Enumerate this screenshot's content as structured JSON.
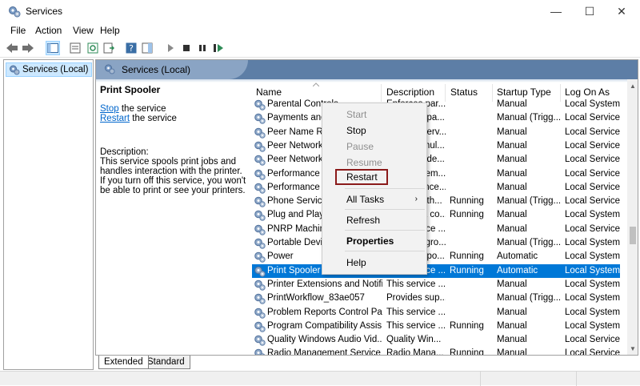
{
  "window": {
    "title": "Services",
    "controls": {
      "minimize": "—",
      "maximize": "☐",
      "close": "✕"
    }
  },
  "menu": [
    "File",
    "Action",
    "View",
    "Help"
  ],
  "tree": {
    "item": "Services (Local)"
  },
  "panel": {
    "header": "Services (Local)",
    "selected_service": "Print Spooler",
    "stop_link": "Stop",
    "stop_rest": " the service",
    "restart_link": "Restart",
    "restart_rest": " the service",
    "description_label": "Description:",
    "description_lines": [
      "This service spools print jobs and",
      "handles interaction with the printer.",
      "If you turn off this service, you won't",
      "be able to print or see your printers."
    ]
  },
  "columns": [
    "Name",
    "Description",
    "Status",
    "Startup Type",
    "Log On As"
  ],
  "rows": [
    {
      "name": "Parental Controls",
      "desc": "Enforces par...",
      "status": "",
      "startup": "Manual",
      "logon": "Local System"
    },
    {
      "name": "Payments and NFC/SE Ma...",
      "desc": "Manages pa...",
      "status": "",
      "startup": "Manual (Trigg...",
      "logon": "Local Service"
    },
    {
      "name": "Peer Name Resolution Pr...",
      "desc": "Enables serv...",
      "status": "",
      "startup": "Manual",
      "logon": "Local Service"
    },
    {
      "name": "Peer Networking Groupi...",
      "desc": "Enables mul...",
      "status": "",
      "startup": "Manual",
      "logon": "Local Service"
    },
    {
      "name": "Peer Networking Identity...",
      "desc": "Provides ide...",
      "status": "",
      "startup": "Manual",
      "logon": "Local Service"
    },
    {
      "name": "Performance Counter DL...",
      "desc": "Enables rem...",
      "status": "",
      "startup": "Manual",
      "logon": "Local Service"
    },
    {
      "name": "Performance Logs & Aler...",
      "desc": "Performance...",
      "status": "",
      "startup": "Manual",
      "logon": "Local Service"
    },
    {
      "name": "Phone Service",
      "desc": "Manages th...",
      "status": "Running",
      "startup": "Manual (Trigg...",
      "logon": "Local Service"
    },
    {
      "name": "Plug and Play",
      "desc": "Enables a co...",
      "status": "Running",
      "startup": "Manual",
      "logon": "Local System"
    },
    {
      "name": "PNRP Machine Name Pub...",
      "desc": "This service ...",
      "status": "",
      "startup": "Manual",
      "logon": "Local Service"
    },
    {
      "name": "Portable Device Enumera...",
      "desc": "Enforces gro...",
      "status": "",
      "startup": "Manual (Trigg...",
      "logon": "Local System"
    },
    {
      "name": "Power",
      "desc": "Manages po...",
      "status": "Running",
      "startup": "Automatic",
      "logon": "Local System"
    },
    {
      "name": "Print Spooler",
      "desc": "This service ...",
      "status": "Running",
      "startup": "Automatic",
      "logon": "Local System"
    },
    {
      "name": "Printer Extensions and Notifi...",
      "desc": "This service ...",
      "status": "",
      "startup": "Manual",
      "logon": "Local System"
    },
    {
      "name": "PrintWorkflow_83ae057",
      "desc": "Provides sup...",
      "status": "",
      "startup": "Manual (Trigg...",
      "logon": "Local System"
    },
    {
      "name": "Problem Reports Control Pa...",
      "desc": "This service ...",
      "status": "",
      "startup": "Manual",
      "logon": "Local System"
    },
    {
      "name": "Program Compatibility Assis...",
      "desc": "This service ...",
      "status": "Running",
      "startup": "Manual",
      "logon": "Local System"
    },
    {
      "name": "Quality Windows Audio Vid...",
      "desc": "Quality Win...",
      "status": "",
      "startup": "Manual",
      "logon": "Local Service"
    },
    {
      "name": "Radio Management Service",
      "desc": "Radio Mana...",
      "status": "Running",
      "startup": "Manual",
      "logon": "Local Service"
    }
  ],
  "context_menu": {
    "start": "Start",
    "stop": "Stop",
    "pause": "Pause",
    "resume": "Resume",
    "restart": "Restart",
    "all_tasks": "All Tasks",
    "refresh": "Refresh",
    "properties": "Properties",
    "help": "Help",
    "submenu_arrow": "›"
  },
  "tabs": [
    "Extended",
    "Standard"
  ],
  "colors": {
    "selection": "#0078d7",
    "header": "#5d7ea6",
    "link": "#0066cc",
    "highlight_border": "#8b1a1a"
  }
}
